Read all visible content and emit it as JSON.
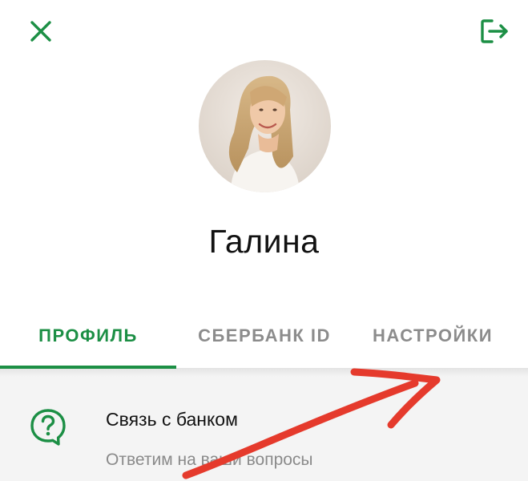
{
  "header": {
    "close_icon": "close-icon",
    "logout_icon": "logout-icon"
  },
  "profile": {
    "name": "Галина"
  },
  "tabs": [
    {
      "label": "ПРОФИЛЬ",
      "active": true
    },
    {
      "label": "СБЕРБАНК ID",
      "active": false
    },
    {
      "label": "НАСТРОЙКИ",
      "active": false
    }
  ],
  "list": [
    {
      "icon": "help-chat-icon",
      "title": "Связь с банком",
      "subtitle": "Ответим на ваши вопросы"
    }
  ],
  "colors": {
    "accent": "#1c8f45",
    "tab_inactive": "#8c8c8c",
    "content_background": "#f4f4f4",
    "annotation_arrow": "#e53a2c"
  }
}
